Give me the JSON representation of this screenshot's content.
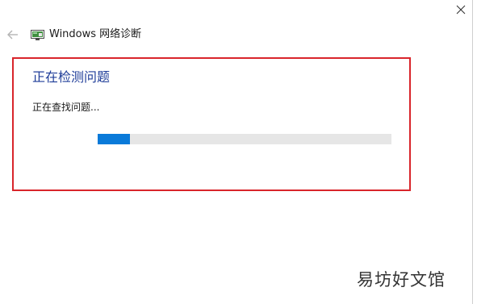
{
  "window": {
    "title": "Windows 网络诊断",
    "close_icon": "close-icon",
    "back_icon": "back-arrow-icon",
    "app_icon": "network-diagnostics-icon"
  },
  "main": {
    "heading": "正在检测问题",
    "status": "正在查找问题...",
    "progress": 0.11,
    "highlight_color": "#d9252b",
    "accent_color": "#0a7ad9",
    "heading_color": "#1f3d99"
  },
  "watermark": {
    "text": "易坊好文馆"
  }
}
